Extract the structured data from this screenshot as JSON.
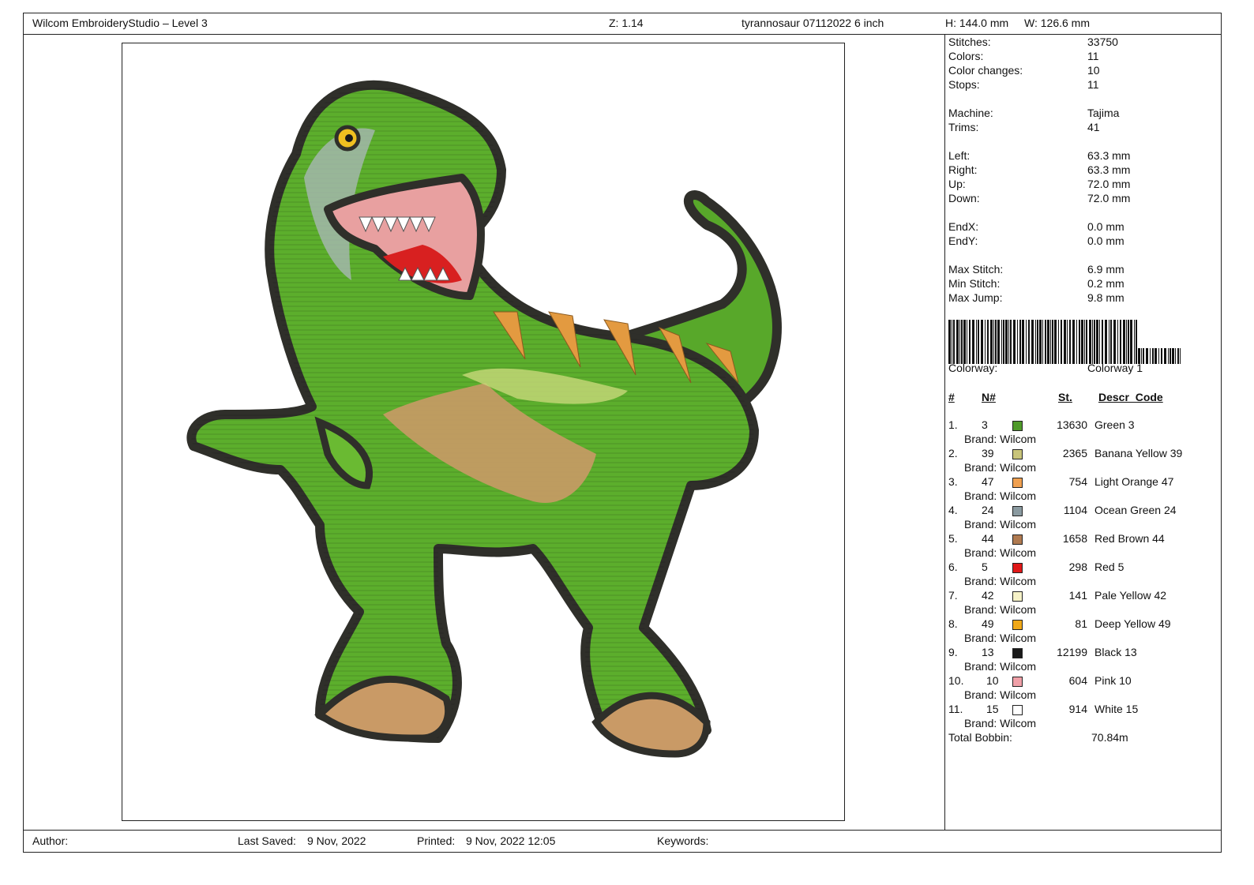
{
  "header": {
    "app_title": "Wilcom EmbroideryStudio – Level 3",
    "zoom": "Z: 1.14",
    "design_name": "tyrannosaur 07112022 6 inch",
    "height": "H: 144.0 mm",
    "width": "W: 126.6 mm"
  },
  "stats": [
    {
      "label": "Stitches:",
      "value": "33750"
    },
    {
      "label": "Colors:",
      "value": "11"
    },
    {
      "label": "Color changes:",
      "value": "10"
    },
    {
      "label": "Stops:",
      "value": "11"
    },
    {
      "label": "Machine:",
      "value": "Tajima"
    },
    {
      "label": "Trims:",
      "value": "41"
    },
    {
      "label": "Left:",
      "value": "63.3 mm"
    },
    {
      "label": "Right:",
      "value": "63.3 mm"
    },
    {
      "label": "Up:",
      "value": "72.0 mm"
    },
    {
      "label": "Down:",
      "value": "72.0 mm"
    },
    {
      "label": "EndX:",
      "value": "0.0 mm"
    },
    {
      "label": "EndY:",
      "value": "0.0 mm"
    },
    {
      "label": "Max Stitch:",
      "value": "6.9 mm"
    },
    {
      "label": "Min Stitch:",
      "value": "0.2 mm"
    },
    {
      "label": "Max Jump:",
      "value": "9.8 mm"
    }
  ],
  "colorway": {
    "label": "Colorway:",
    "value": "Colorway 1"
  },
  "table": {
    "col_index": "#",
    "col_needle": "N#",
    "col_stitches": "St.",
    "col_descr": "Descr_Code",
    "brand_prefix": "Brand: Wilcom",
    "rows": [
      {
        "idx": "1.",
        "needle": "3",
        "color": "#4f9a2a",
        "stitches": "13630",
        "descr": "Green 3"
      },
      {
        "idx": "2.",
        "needle": "39",
        "color": "#c8c47a",
        "stitches": "2365",
        "descr": "Banana Yellow 39"
      },
      {
        "idx": "3.",
        "needle": "47",
        "color": "#f0a050",
        "stitches": "754",
        "descr": "Light Orange 47"
      },
      {
        "idx": "4.",
        "needle": "24",
        "color": "#8a9aa0",
        "stitches": "1104",
        "descr": "Ocean Green 24"
      },
      {
        "idx": "5.",
        "needle": "44",
        "color": "#b07a50",
        "stitches": "1658",
        "descr": "Red Brown 44"
      },
      {
        "idx": "6.",
        "needle": "5",
        "color": "#e01818",
        "stitches": "298",
        "descr": "Red 5"
      },
      {
        "idx": "7.",
        "needle": "42",
        "color": "#f6f2c8",
        "stitches": "141",
        "descr": "Pale Yellow 42"
      },
      {
        "idx": "8.",
        "needle": "49",
        "color": "#f0a818",
        "stitches": "81",
        "descr": "Deep Yellow 49"
      },
      {
        "idx": "9.",
        "needle": "13",
        "color": "#1a1a1a",
        "stitches": "12199",
        "descr": "Black 13"
      },
      {
        "idx": "10.",
        "needle": "10",
        "color": "#f0a0a8",
        "stitches": "604",
        "descr": "Pink 10"
      },
      {
        "idx": "11.",
        "needle": "15",
        "color": "#ffffff",
        "stitches": "914",
        "descr": "White 15"
      }
    ],
    "total_label": "Total Bobbin:",
    "total_value": "70.84m"
  },
  "footer": {
    "author_label": "Author:",
    "last_saved_label": "Last Saved:",
    "last_saved_value": "9 Nov, 2022",
    "printed_label": "Printed:",
    "printed_value": "9 Nov, 2022 12:05",
    "keywords_label": "Keywords:"
  }
}
